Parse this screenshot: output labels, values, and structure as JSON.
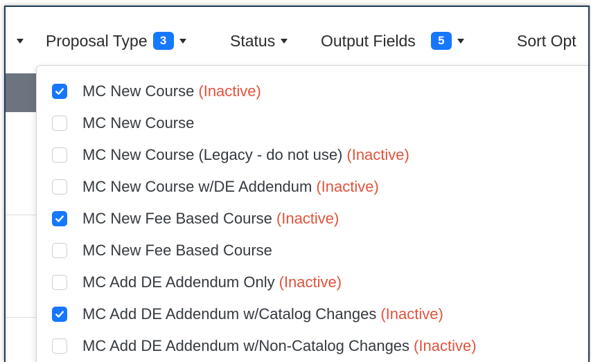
{
  "toolbar": {
    "proposal_type_label": "Proposal Type",
    "proposal_type_count": "3",
    "status_label": "Status",
    "output_fields_label": "Output Fields",
    "output_fields_count": "5",
    "sort_label": "Sort Opt"
  },
  "inactive_label": "(Inactive)",
  "options": [
    {
      "label": "MC New Course",
      "inactive": true,
      "checked": true
    },
    {
      "label": "MC New Course",
      "inactive": false,
      "checked": false
    },
    {
      "label": "MC New Course (Legacy - do not use)",
      "inactive": true,
      "checked": false
    },
    {
      "label": "MC New Course w/DE Addendum",
      "inactive": true,
      "checked": false
    },
    {
      "label": "MC New Fee Based Course",
      "inactive": true,
      "checked": true
    },
    {
      "label": "MC New Fee Based Course",
      "inactive": false,
      "checked": false
    },
    {
      "label": "MC Add DE Addendum Only",
      "inactive": true,
      "checked": false
    },
    {
      "label": "MC Add DE Addendum w/Catalog Changes",
      "inactive": true,
      "checked": true
    },
    {
      "label": "MC Add DE Addendum w/Non-Catalog Changes",
      "inactive": true,
      "checked": false
    }
  ],
  "colors": {
    "accent": "#1677ff",
    "inactive": "#e0533d",
    "border": "#1f3b57"
  }
}
